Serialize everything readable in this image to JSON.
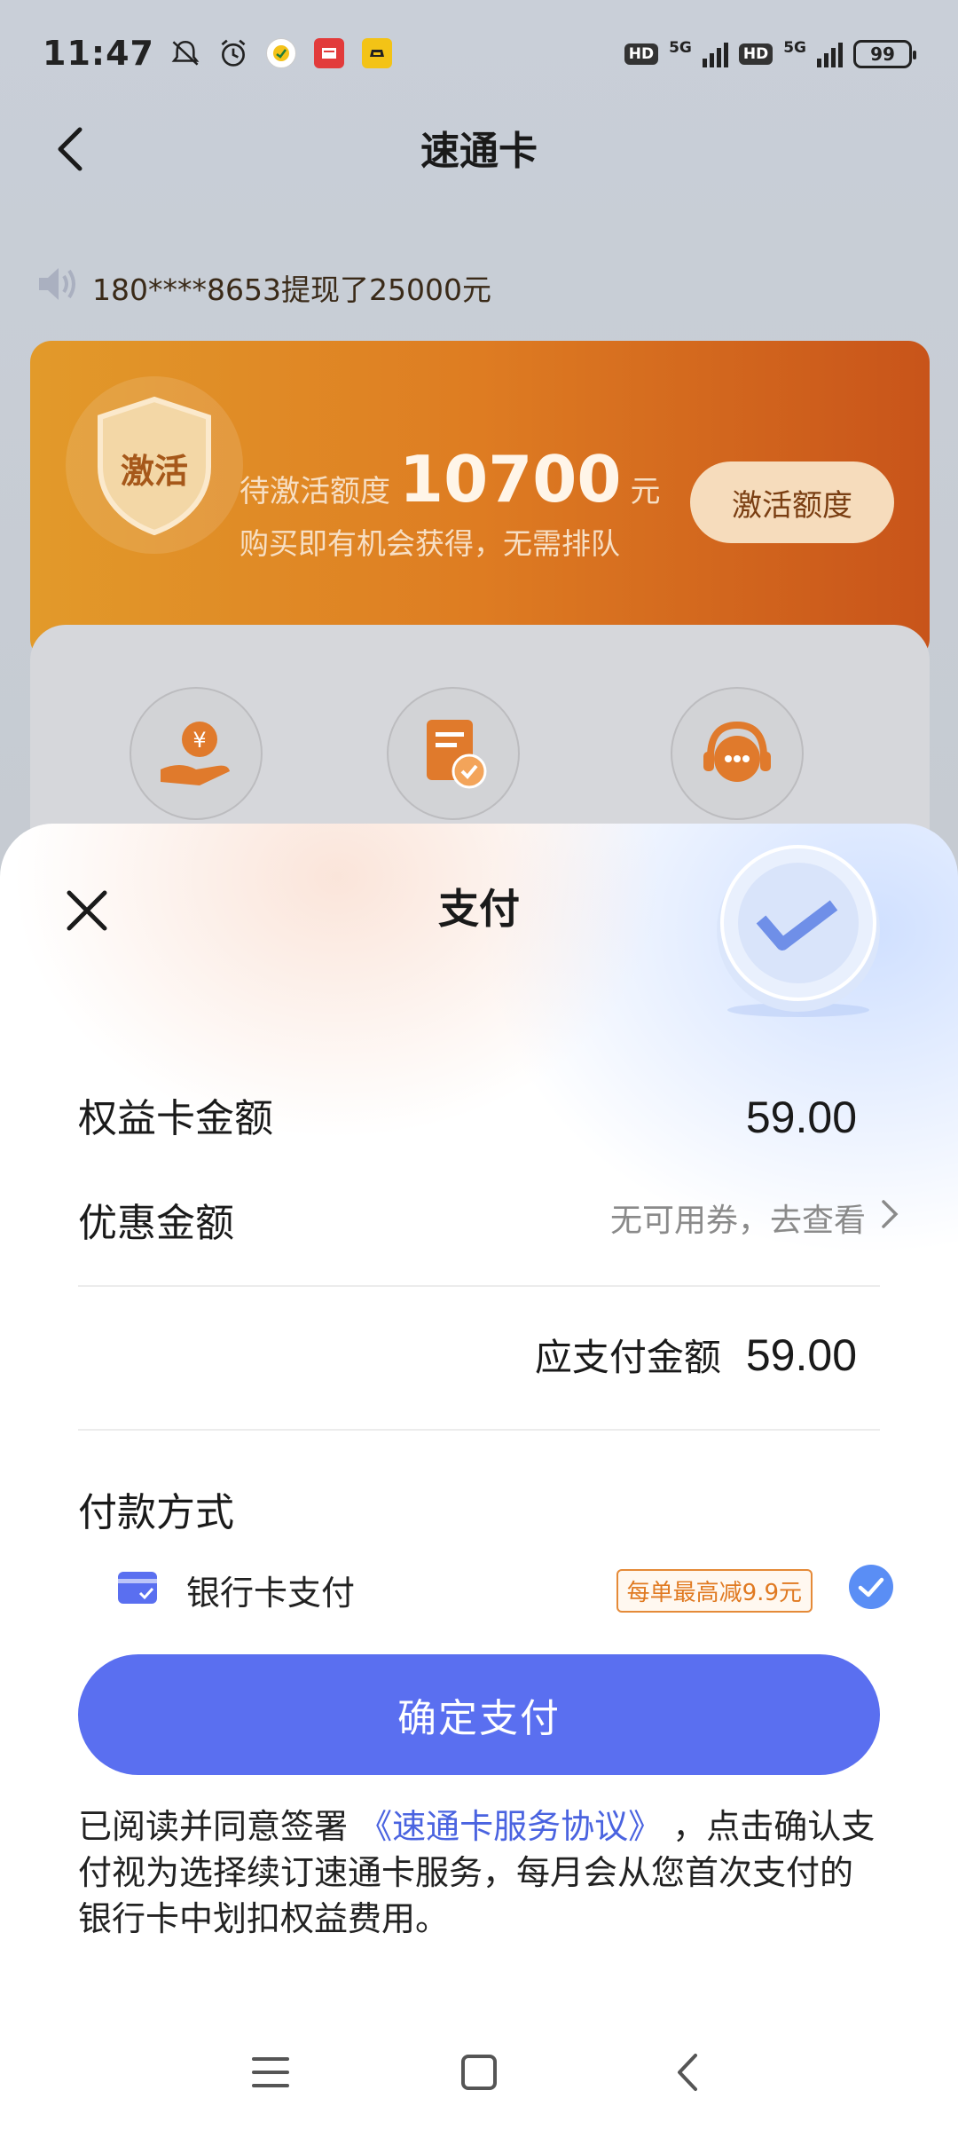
{
  "status_bar": {
    "time": "11:47",
    "network_1": "5G",
    "network_2": "5G",
    "hd_1": "HD",
    "hd_2": "HD",
    "battery": "99"
  },
  "nav": {
    "title": "速通卡",
    "back_icon": "back-arrow-icon"
  },
  "marquee": {
    "text": "180****8653提现了25000元",
    "icon": "speaker-icon"
  },
  "promo": {
    "badge_label": "激活",
    "pending_label": "待激活额度",
    "amount": "10700",
    "unit": "元",
    "subtitle": "购买即有机会获得，无需排队",
    "button_label": "激活额度",
    "colors": {
      "start": "#e29a2a",
      "end": "#c8541a"
    }
  },
  "feature_icons": [
    "cash-hand-icon",
    "document-check-icon",
    "customer-service-icon"
  ],
  "sheet": {
    "title": "支付",
    "card_amount_label": "权益卡金额",
    "card_amount_value": "59.00",
    "discount_label": "优惠金额",
    "discount_link": "无可用券，去查看",
    "payable_label": "应支付金额",
    "payable_value": "59.00",
    "method_title": "付款方式",
    "method": {
      "label": "银行卡支付",
      "badge": "每单最高减9.9元",
      "selected": true
    },
    "confirm_label": "确定支付",
    "agreement": {
      "prefix": "已阅读并同意签署",
      "link": "《速通卡服务协议》",
      "suffix": "，点击确认支付视为选择续订速通卡服务，每月会从您首次支付的银行卡中划扣权益费用。"
    },
    "accent_color": "#5a6ff0"
  }
}
